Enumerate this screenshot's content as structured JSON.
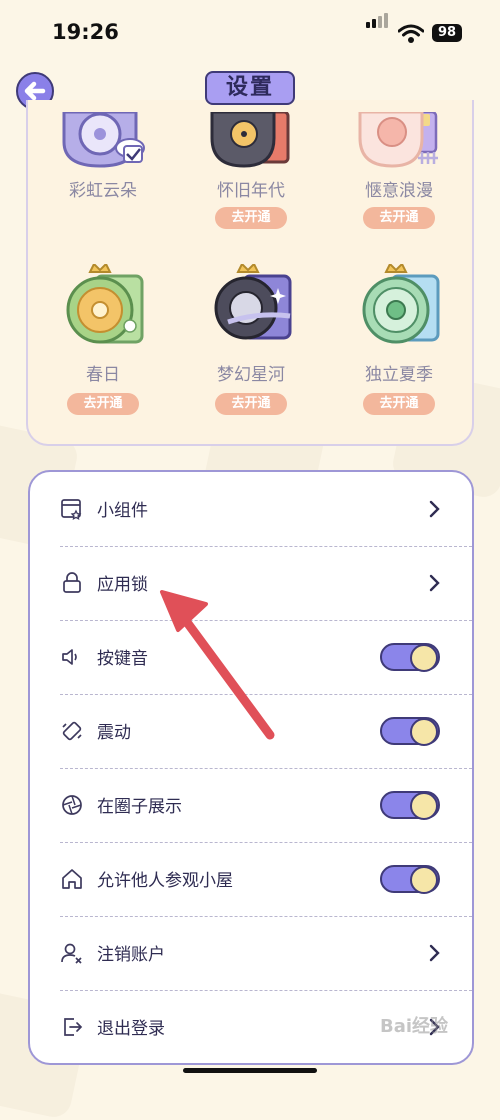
{
  "status_bar": {
    "time": "19:26",
    "battery": "98"
  },
  "header": {
    "title": "设置"
  },
  "themes": [
    {
      "name": "彩虹云朵",
      "action": ""
    },
    {
      "name": "怀旧年代",
      "action": "去开通"
    },
    {
      "name": "惬意浪漫",
      "action": "去开通"
    },
    {
      "name": "春日",
      "action": "去开通"
    },
    {
      "name": "梦幻星河",
      "action": "去开通"
    },
    {
      "name": "独立夏季",
      "action": "去开通"
    }
  ],
  "settings": {
    "widget": "小组件",
    "app_lock": "应用锁",
    "key_sound": "按键音",
    "vibration": "震动",
    "show_in_circle": "在圈子展示",
    "allow_visit": "允许他人参观小屋",
    "delete_account": "注销账户",
    "logout": "退出登录"
  },
  "toggles": {
    "key_sound": true,
    "vibration": true,
    "show_in_circle": true,
    "allow_visit": true
  },
  "watermark": "Bai经验",
  "colors": {
    "accent": "#8b85ea",
    "outline": "#3f3a78",
    "action_pill": "#f3b79c",
    "background": "#fcf6e7",
    "annotation_arrow": "#e05058"
  }
}
